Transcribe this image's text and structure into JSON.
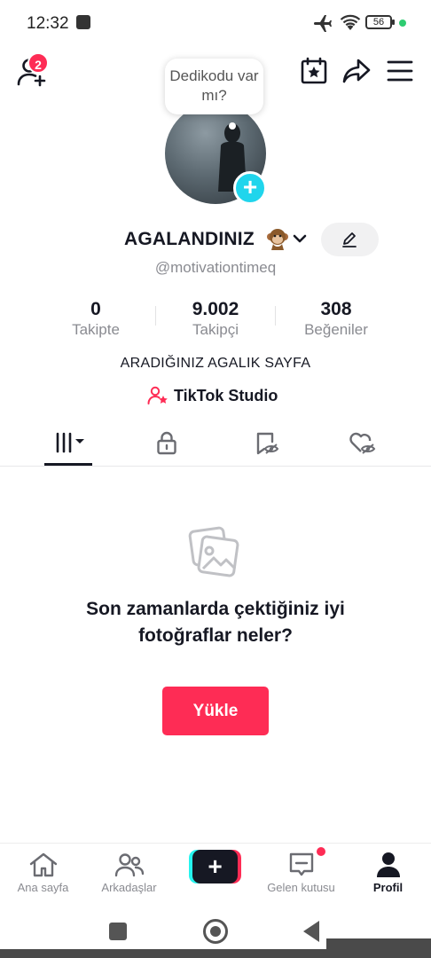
{
  "status_bar": {
    "time": "12:32",
    "battery": "56",
    "icons": [
      "stop-square-icon",
      "airplane-icon",
      "wifi-icon",
      "battery-icon",
      "green-dot-icon"
    ]
  },
  "header": {
    "friend_requests_badge": "2",
    "icons": [
      "add-friend-icon",
      "calendar-star-icon",
      "share-arrow-icon",
      "hamburger-menu-icon"
    ]
  },
  "profile": {
    "thought_bubble": "Dedikodu var mı?",
    "display_name": "AGALANDINIZ",
    "handle": "@motivationtimeq",
    "bio": "ARADIĞINIZ AGALIK SAYFA",
    "studio_link": "TikTok Studio"
  },
  "stats": [
    {
      "value": "0",
      "label": "Takipte"
    },
    {
      "value": "9.002",
      "label": "Takipçi"
    },
    {
      "value": "308",
      "label": "Beğeniler"
    }
  ],
  "tabs": [
    {
      "name": "videos-grid",
      "icon": "grid-bars-dropdown-icon",
      "active": true
    },
    {
      "name": "private",
      "icon": "lock-icon",
      "active": false
    },
    {
      "name": "saved",
      "icon": "bookmark-eye-icon",
      "active": false
    },
    {
      "name": "liked",
      "icon": "heart-eye-icon",
      "active": false
    }
  ],
  "empty_state": {
    "icon": "photos-icon",
    "title": "Son zamanlarda çektiğiniz iyi fotoğraflar neler?",
    "button": "Yükle"
  },
  "bottom_nav": [
    {
      "label": "Ana sayfa",
      "icon": "home-icon",
      "active": false
    },
    {
      "label": "Arkadaşlar",
      "icon": "friends-icon",
      "active": false
    },
    {
      "label": "",
      "icon": "create-plus-icon",
      "active": false
    },
    {
      "label": "Gelen kutusu",
      "icon": "inbox-icon",
      "active": false
    },
    {
      "label": "Profil",
      "icon": "profile-icon",
      "active": true
    }
  ],
  "colors": {
    "accent": "#fe2c55",
    "cyan": "#25f4ee",
    "text": "#161823",
    "muted": "#8a8b91"
  }
}
